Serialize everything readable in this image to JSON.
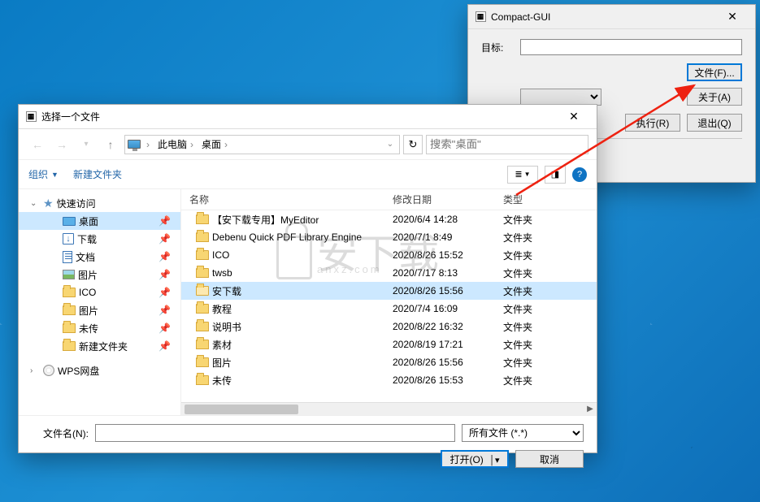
{
  "compact_gui": {
    "title": "Compact-GUI",
    "target_label": "目标:",
    "target_value": "",
    "buttons": {
      "file": "文件(F)...",
      "about": "关于(A)",
      "execute": "执行(R)",
      "exit": "退出(Q)"
    }
  },
  "file_dialog": {
    "title": "选择一个文件",
    "breadcrumb": {
      "this_pc": "此电脑",
      "desktop": "桌面"
    },
    "search_placeholder": "搜索\"桌面\"",
    "toolbar": {
      "organize": "组织",
      "new_folder": "新建文件夹"
    },
    "tree": {
      "quick_access": "快速访问",
      "items": [
        {
          "label": "桌面",
          "icon": "desktop",
          "pinned": true,
          "selected": true
        },
        {
          "label": "下载",
          "icon": "download",
          "pinned": true
        },
        {
          "label": "文档",
          "icon": "doc",
          "pinned": true
        },
        {
          "label": "图片",
          "icon": "pic",
          "pinned": true
        },
        {
          "label": "ICO",
          "icon": "folder",
          "pinned": true
        },
        {
          "label": "图片",
          "icon": "folder",
          "pinned": true
        },
        {
          "label": "未传",
          "icon": "folder",
          "pinned": true
        },
        {
          "label": "新建文件夹",
          "icon": "folder",
          "pinned": true
        }
      ],
      "wps": "WPS网盘"
    },
    "columns": {
      "name": "名称",
      "date": "修改日期",
      "type": "类型"
    },
    "rows": [
      {
        "name": "【安下载专用】MyEditor",
        "date": "2020/6/4 14:28",
        "type": "文件夹"
      },
      {
        "name": "Debenu Quick PDF Library Engine",
        "date": "2020/7/1 8:49",
        "type": "文件夹"
      },
      {
        "name": "ICO",
        "date": "2020/8/26 15:52",
        "type": "文件夹"
      },
      {
        "name": "twsb",
        "date": "2020/7/17 8:13",
        "type": "文件夹"
      },
      {
        "name": "安下载",
        "date": "2020/8/26 15:56",
        "type": "文件夹",
        "selected": true
      },
      {
        "name": "教程",
        "date": "2020/7/4 16:09",
        "type": "文件夹"
      },
      {
        "name": "说明书",
        "date": "2020/8/22 16:32",
        "type": "文件夹"
      },
      {
        "name": "素材",
        "date": "2020/8/19 17:21",
        "type": "文件夹"
      },
      {
        "name": "图片",
        "date": "2020/8/26 15:56",
        "type": "文件夹"
      },
      {
        "name": "未传",
        "date": "2020/8/26 15:53",
        "type": "文件夹"
      }
    ],
    "filename_label": "文件名(N):",
    "filename_value": "",
    "filter": "所有文件 (*.*)",
    "open": "打开(O)",
    "cancel": "取消"
  },
  "watermark": {
    "main": "安下载",
    "sub": "anxz.com"
  }
}
